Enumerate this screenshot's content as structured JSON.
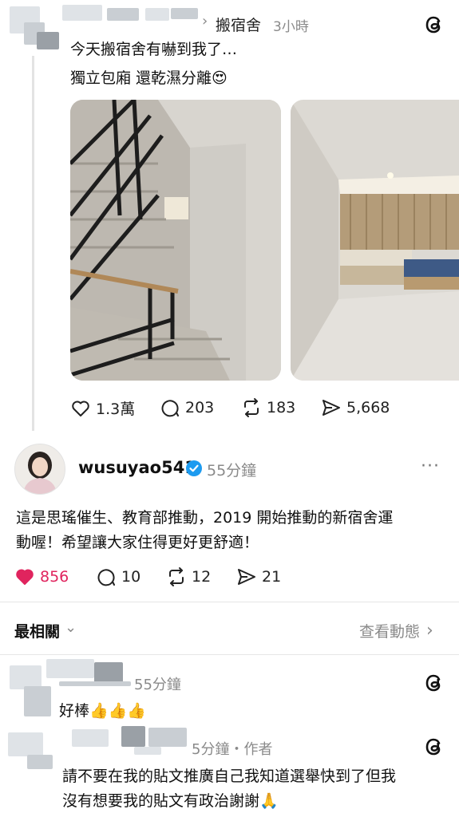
{
  "post": {
    "breadcrumb_arrow": "›",
    "channel": "搬宿舍",
    "time": "3小時",
    "text_line1": "今天搬宿舍有嚇到我了…",
    "text_line2": "獨立包廂 還乾濕分離😍",
    "stats": {
      "likes": "1.3萬",
      "comments": "203",
      "reposts": "183",
      "shares": "5,668"
    }
  },
  "reply": {
    "username": "wusuyao541",
    "time": "55分鐘",
    "more": "···",
    "text_line1": "這是思瑤催生、教育部推動，2019 開始推動的新宿舍運",
    "text_line2": "動喔！希望讓大家住得更好更舒適！",
    "stats": {
      "likes": "856",
      "comments": "10",
      "reposts": "12",
      "shares": "21"
    }
  },
  "sort": {
    "label": "最相關",
    "chevron": "⌄",
    "view_activity": "查看動態",
    "view_chevron": "›"
  },
  "comments": [
    {
      "time": "55分鐘",
      "text": "好棒👍👍👍"
    },
    {
      "time": "5分鐘・作者",
      "text_line1": "請不要在我的貼文推廣自己我知道選舉快到了但我",
      "text_line2": "沒有想要我的貼文有政治謝謝🙏"
    }
  ],
  "colors": {
    "heart_active": "#e0245e",
    "verified": "#1d9bf0",
    "muted": "#8a8a8a"
  }
}
